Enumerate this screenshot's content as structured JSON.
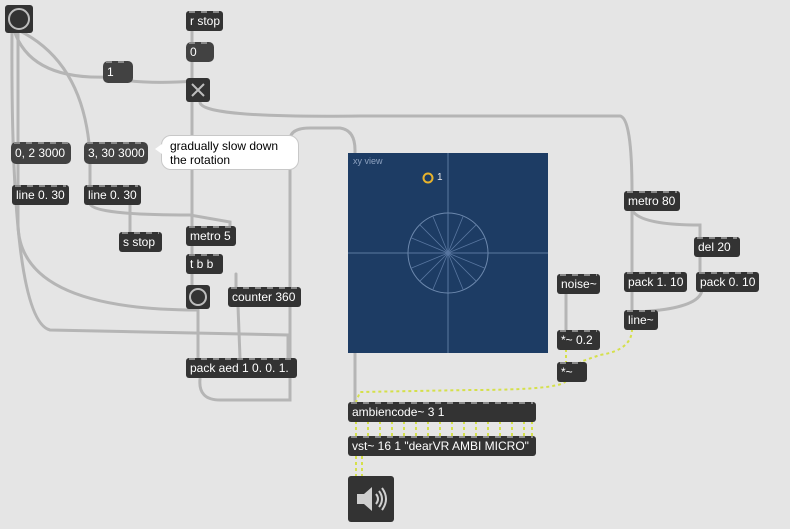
{
  "colors": {
    "canvas_bg": "#e5e5e5",
    "object_bg": "#333333",
    "cord_grey": "#b5b5b5",
    "cord_signal": "#d5e04a",
    "xy_bg": "#1d3c64",
    "source_dot": "#e8b32c"
  },
  "objects": {
    "r_stop": "r stop",
    "msg_zero": "0",
    "msg_one": "1",
    "msg_0_2_3000": "0, 2 3000",
    "msg_3_30_3000": "3, 30 3000",
    "line_a": "line 0. 30",
    "line_b": "line 0. 30",
    "s_stop": "s stop",
    "metro5": "metro 5",
    "tbb": "t b b",
    "counter": "counter 360",
    "pack_aed": "pack aed 1 0. 0. 1.",
    "ambiencode": "ambiencode~ 3 1",
    "vst": "vst~ 16 1 \"dearVR AMBI MICRO\"",
    "noise": "noise~",
    "mult_02": "*~ 0.2",
    "mult": "*~",
    "metro80": "metro 80",
    "del20": "del 20",
    "pack_1_10": "pack 1. 10",
    "pack_0_10": "pack 0. 10",
    "line_tilde": "line~"
  },
  "comment": {
    "line1": "gradually slow down",
    "line2": "the rotation"
  },
  "xy_view": {
    "title": "xy view",
    "source_label": "1"
  },
  "icons": {
    "bang": "bang-icon",
    "toggle": "toggle-x-icon",
    "speaker": "speaker-icon"
  }
}
